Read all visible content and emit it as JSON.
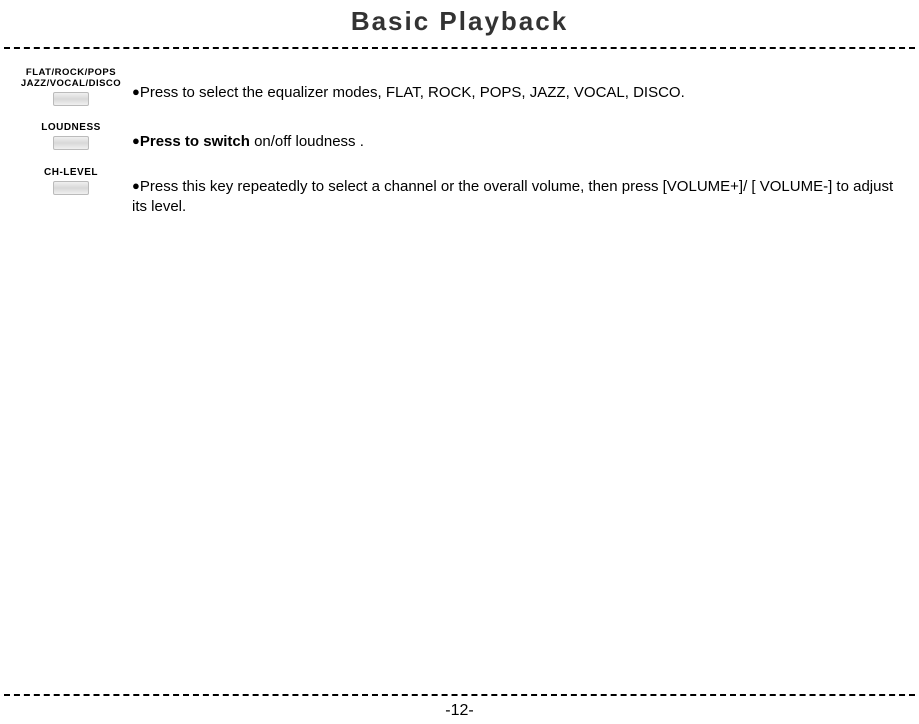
{
  "title": "Basic Playback",
  "rows": [
    {
      "label_line1": "FLAT/ROCK/POPS",
      "label_line2": "JAZZ/VOCAL/DISCO",
      "desc": "Press to select the equalizer modes, FLAT, ROCK, POPS, JAZZ, VOCAL, DISCO."
    },
    {
      "label_line1": "LOUDNESS",
      "desc_bold": "Press to switch",
      "desc_rest": " on/off loudness ."
    },
    {
      "label_line1": "CH-LEVEL",
      "desc": "Press this key repeatedly to select a channel or the overall volume, then press [VOLUME+]/ [ VOLUME-] to adjust its level."
    }
  ],
  "page_number": "-12-",
  "bullet": "●"
}
